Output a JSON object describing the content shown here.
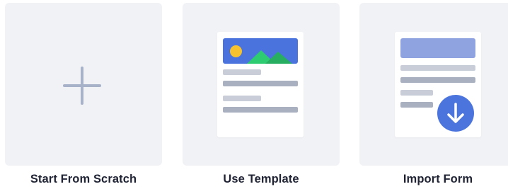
{
  "options": {
    "scratch": {
      "label": "Start From Scratch",
      "icon": "plus-icon"
    },
    "template": {
      "label": "Use Template",
      "icon": "template-document-icon"
    },
    "import": {
      "label": "Import Form",
      "icon": "import-document-icon"
    }
  },
  "colors": {
    "tile_bg": "#f1f2f6",
    "accent_blue": "#4b74dd",
    "light_blue": "#8ea3e0",
    "sun_yellow": "#f5c22d",
    "mountain_green": "#2ecc71",
    "placeholder_gray": "#a9b0c0",
    "placeholder_light": "#c8cdd8",
    "text": "#1f2333"
  }
}
